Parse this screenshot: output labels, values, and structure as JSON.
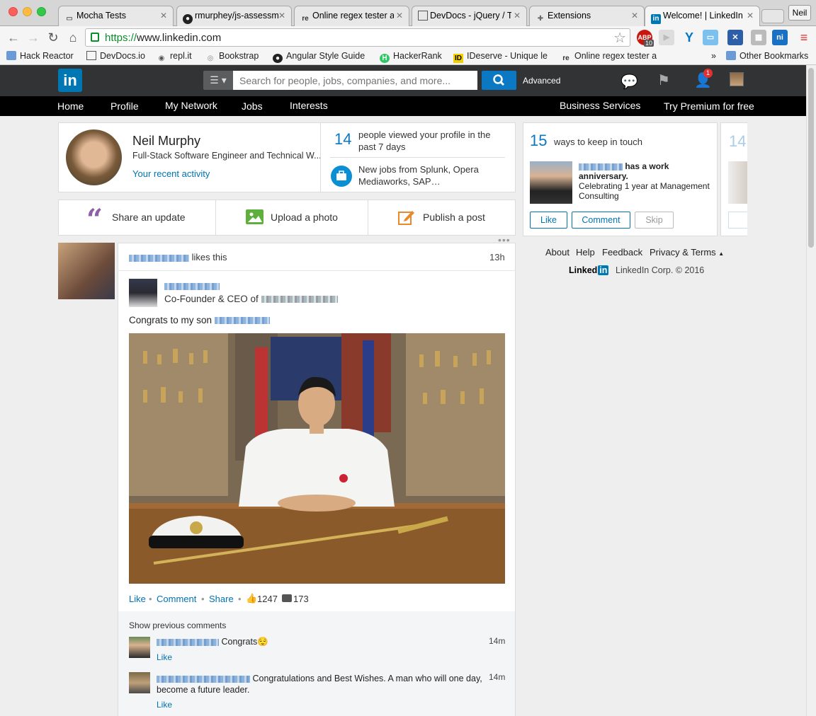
{
  "browser": {
    "tabs": [
      {
        "label": "Mocha Tests",
        "icon": "document-icon"
      },
      {
        "label": "rmurphey/js-assessm",
        "icon": "github-icon"
      },
      {
        "label": "Online regex tester a",
        "icon": "regex101-icon"
      },
      {
        "label": "DevDocs - jQuery / T",
        "icon": "devdocs-icon"
      },
      {
        "label": "Extensions",
        "icon": "puzzle-icon"
      },
      {
        "label": "Welcome! | LinkedIn",
        "icon": "linkedin-icon"
      }
    ],
    "profile_name": "Neil",
    "url_scheme": "https://",
    "url_rest": "www.linkedin.com",
    "abp_count": "10",
    "bookmarks": [
      {
        "label": "Hack Reactor",
        "icon": "folder-icon"
      },
      {
        "label": "DevDocs.io",
        "icon": "devdocs-icon"
      },
      {
        "label": "repl.it",
        "icon": "replit-icon"
      },
      {
        "label": "Bookstrap",
        "icon": "bookstrap-icon"
      },
      {
        "label": "Angular Style Guide",
        "icon": "github-icon"
      },
      {
        "label": "HackerRank",
        "icon": "hackerrank-icon"
      },
      {
        "label": "IDeserve - Unique le",
        "icon": "ideserve-icon"
      },
      {
        "label": "Online regex tester a",
        "icon": "regex101-icon"
      }
    ],
    "more_bookmarks": "»",
    "other_bookmarks": "Other Bookmarks"
  },
  "linkedin": {
    "logo": "in",
    "search_placeholder": "Search for people, jobs, companies, and more...",
    "advanced": "Advanced",
    "notification_count": "1",
    "nav": [
      "Home",
      "Profile",
      "My Network",
      "Jobs",
      "Interests"
    ],
    "nav_right": [
      "Business Services",
      "Try Premium for free"
    ],
    "profile_card": {
      "name": "Neil Murphy",
      "headline": "Full-Stack Software Engineer and Technical W...",
      "activity": "Your recent activity",
      "views_count": "14",
      "views_text": "people viewed your profile in the past 7 days",
      "jobs_text": "New jobs from Splunk, Opera Mediaworks, SAP…"
    },
    "share_bar": {
      "share": "Share an update",
      "upload": "Upload a photo",
      "publish": "Publish a post"
    },
    "post": {
      "likes_this": "likes this",
      "time": "13h",
      "author_title": "Co-Founder & CEO of",
      "body": "Congrats to my son",
      "actions": {
        "like": "Like",
        "comment": "Comment",
        "share": "Share"
      },
      "like_count": "1247",
      "comment_count": "173",
      "show_previous": "Show previous comments",
      "comments": [
        {
          "text": "Congrats😌",
          "time": "14m",
          "like": "Like"
        },
        {
          "text": "Congratulations and Best Wishes. A man who will one day, become a future leader.",
          "time": "14m",
          "like": "Like"
        }
      ]
    },
    "keep_in_touch": {
      "count": "15",
      "text": "ways to keep in touch",
      "has_work": "has a work",
      "anniversary": "anniversary.",
      "detail": "Celebrating 1 year at Management Consulting",
      "buttons": {
        "like": "Like",
        "comment": "Comment",
        "skip": "Skip"
      },
      "next_count": "14"
    },
    "footer": {
      "links": [
        "About",
        "Help",
        "Feedback",
        "Privacy & Terms"
      ],
      "brand": "Linked",
      "brand_in": "in",
      "copyright": "LinkedIn Corp. © 2016"
    }
  }
}
